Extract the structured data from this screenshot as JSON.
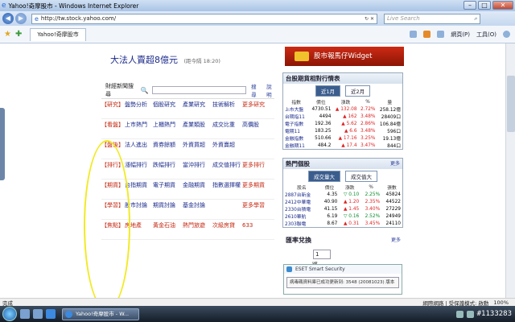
{
  "window": {
    "title": "Yahoo!奇摩股市 - Windows Internet Explorer"
  },
  "address": {
    "url": "http://tw.stock.yahoo.com/",
    "search_placeholder": "Live Search"
  },
  "tabs": [
    {
      "label": "Yahoo!奇摩股市"
    }
  ],
  "commands": {
    "page": "網頁(P)",
    "tools": "工具(O)"
  },
  "page": {
    "headline": "大法人賣超8億元",
    "headline_time": "(距今隔 18:20)",
    "search_label": "財經新聞搜尋",
    "search_btn": "搜尋",
    "search_adv": "說明",
    "grid": [
      [
        "【研究】",
        "盤勢分析",
        "個股研究",
        "產業研究",
        "技術解析",
        "更多研究"
      ],
      [
        "【看盤】",
        "上市熱門",
        "上櫃熱門",
        "產業類股",
        "成交比重",
        "高價股"
      ],
      [
        "【盤後】",
        "法人進出",
        "資券餘額",
        "外資買超",
        "外資賣超",
        ""
      ],
      [
        "【排行】",
        "漲幅排行",
        "跌幅排行",
        "當沖排行",
        "成交值排行",
        "更多排行"
      ],
      [
        "【期貨】",
        "台指期貨",
        "電子期貨",
        "金融期貨",
        "指數選擇權",
        "更多期貨"
      ],
      [
        "【學習】",
        "股市討論",
        "期貨討論",
        "基金討論",
        "",
        "更多學習"
      ],
      [
        "【焦點】",
        "房地產",
        "黃金石油",
        "熱門旅遊",
        "次級房貸",
        "633"
      ]
    ]
  },
  "widget": {
    "label": "股市報馬仔Widget"
  },
  "indices": {
    "title": "台股期貨相對行情表",
    "tabs": [
      "近1月",
      "近2月"
    ],
    "headers": [
      "指數",
      "價位",
      "漲跌",
      "%",
      "量"
    ],
    "rows": [
      {
        "name": "上市大盤",
        "price": "4730.51",
        "chg": "132.08",
        "pct": "2.72%",
        "vol": "258.12億",
        "dir": "up"
      },
      {
        "name": "台期指11",
        "price": "4494",
        "chg": "162",
        "pct": "3.48%",
        "vol": "28409口",
        "dir": "up"
      },
      {
        "name": "電子指數",
        "price": "192.36",
        "chg": "5.62",
        "pct": "2.86%",
        "vol": "106.84億",
        "dir": "up"
      },
      {
        "name": "電期11",
        "price": "183.25",
        "chg": "6.6",
        "pct": "3.48%",
        "vol": "596口",
        "dir": "up"
      },
      {
        "name": "金融指數",
        "price": "510.66",
        "chg": "17.16",
        "pct": "3.25%",
        "vol": "19.13億",
        "dir": "up"
      },
      {
        "name": "金融期11",
        "price": "484.2",
        "chg": "17.4",
        "pct": "3.47%",
        "vol": "844口",
        "dir": "up"
      }
    ]
  },
  "hot": {
    "title": "熱門個股",
    "more": "更多",
    "tabs": [
      "成交量大",
      "成交值大"
    ],
    "headers": [
      "股名",
      "價位",
      "漲跌",
      "%",
      "張數"
    ],
    "rows": [
      {
        "name": "2887台新金",
        "price": "4.35",
        "chg": "0.10",
        "pct": "2.25%",
        "vol": "45824",
        "dir": "down"
      },
      {
        "name": "2412中華電",
        "price": "40.90",
        "chg": "1.20",
        "pct": "2.35%",
        "vol": "44522",
        "dir": "up"
      },
      {
        "name": "2330台積電",
        "price": "41.15",
        "chg": "1.45",
        "pct": "3.40%",
        "vol": "27229",
        "dir": "up"
      },
      {
        "name": "2610華航",
        "price": "6.19",
        "chg": "0.16",
        "pct": "2.52%",
        "vol": "24949",
        "dir": "down"
      },
      {
        "name": "2303聯電",
        "price": "8.67",
        "chg": "0.31",
        "pct": "3.45%",
        "vol": "24110",
        "dir": "up"
      }
    ]
  },
  "fx": {
    "title": "匯率兌換",
    "more": "更多",
    "amount": "1",
    "unit": "將"
  },
  "eset": {
    "header": "ESET Smart Security",
    "body": "病毒碼資料庫已成功更新到: 3548 (20081023) 版本"
  },
  "status": {
    "left": "完成",
    "zone": "網際網路 | 受保護模式: 啟動",
    "zoom": "100%"
  },
  "taskbar": {
    "task": "Yahoo!奇摩股市 - W...",
    "watermark": "#1133283"
  }
}
